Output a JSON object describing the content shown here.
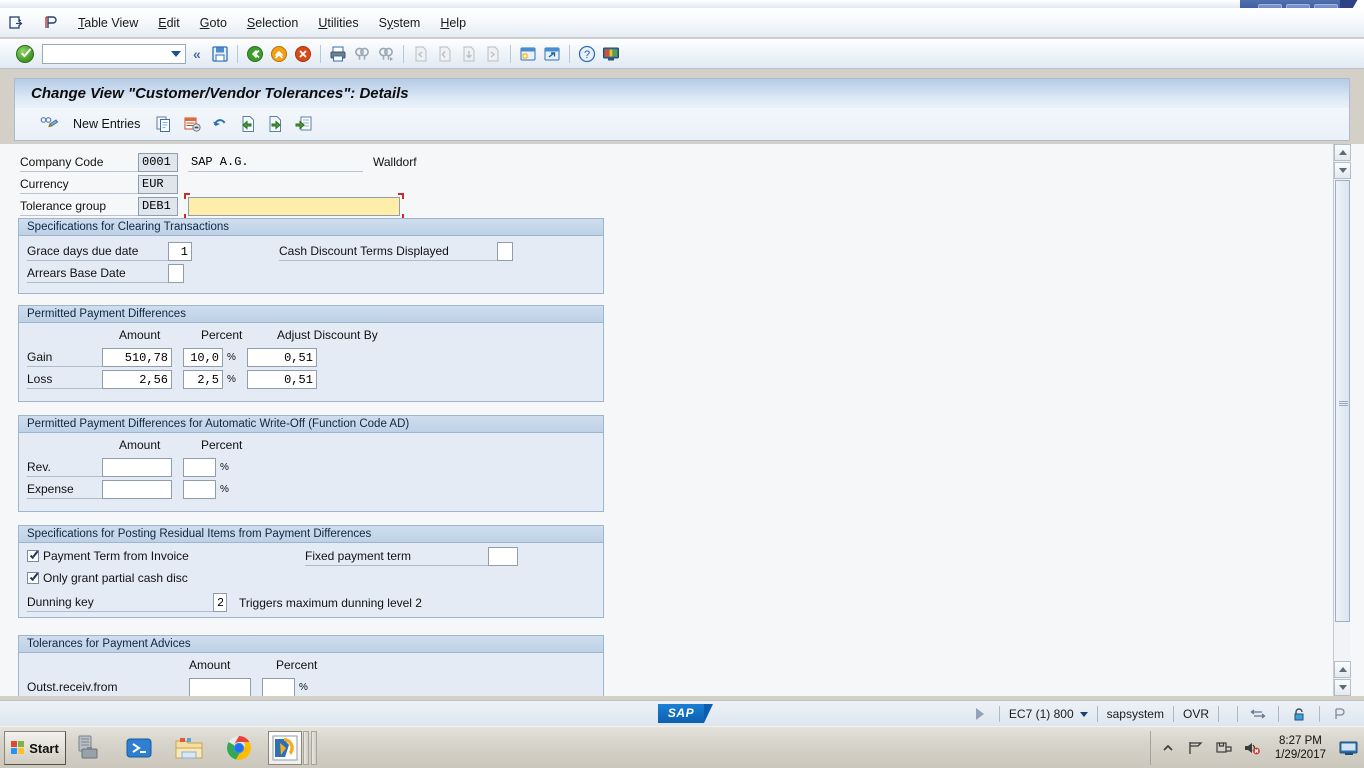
{
  "window": {
    "controls": {
      "minimize": "–",
      "restore": "❐",
      "close": "✕"
    }
  },
  "menubar": {
    "icons": [
      "exit-icon",
      "session-icon"
    ],
    "items": [
      {
        "label": "Table View",
        "accel": "T"
      },
      {
        "label": "Edit",
        "accel": "E"
      },
      {
        "label": "Goto",
        "accel": "G"
      },
      {
        "label": "Selection",
        "accel": "S"
      },
      {
        "label": "Utilities",
        "accel": "U"
      },
      {
        "label": "System",
        "accel": "y"
      },
      {
        "label": "Help",
        "accel": "H"
      }
    ]
  },
  "toolbar": {
    "enter_icon": "green-check-icon",
    "command_field_value": "",
    "command_field_placeholder": "",
    "expand_icon": "chevron-double-left-icon",
    "buttons": [
      "save-icon",
      "back-icon",
      "exit-icon",
      "cancel-icon",
      "print-icon",
      "find-icon",
      "find-next-icon",
      "first-page-icon",
      "previous-page-icon",
      "next-page-icon",
      "last-page-icon",
      "create-session-icon",
      "create-shortcut-icon",
      "help-icon",
      "customize-local-layout-icon"
    ]
  },
  "program": {
    "title": "Change View \"Customer/Vendor Tolerances\": Details"
  },
  "app_toolbar": {
    "display_change_icon": "glasses-pencil-icon",
    "new_entries_label": "New Entries",
    "buttons": [
      "copy-icon",
      "delete-icon",
      "undo-icon",
      "previous-entry-icon",
      "next-entry-icon",
      "select-layout-icon"
    ]
  },
  "header_fields": [
    {
      "label": "Company Code",
      "value": "0001",
      "extra_value": "SAP A.G.",
      "extra2": "Walldorf",
      "style": "gray"
    },
    {
      "label": "Currency",
      "value": "EUR",
      "style": "gray"
    },
    {
      "label": "Tolerance group",
      "value": "DEB1",
      "style": "gray",
      "focus_value": "",
      "focused": true
    }
  ],
  "groups": [
    {
      "title": "Specifications for Clearing Transactions",
      "fields": [
        {
          "label": "Grace days due date",
          "value": "1"
        },
        {
          "label": "Cash Discount Terms Displayed",
          "value": ""
        },
        {
          "label": "Arrears Base Date",
          "value": ""
        }
      ]
    },
    {
      "title": "Permitted Payment Differences",
      "columns": [
        "Amount",
        "Percent",
        "Adjust Discount By"
      ],
      "rows": [
        {
          "label": "Gain",
          "amount": "510,78",
          "percent": "10,0",
          "adjust": "0,51"
        },
        {
          "label": "Loss",
          "amount": "2,56",
          "percent": "2,5",
          "adjust": "0,51"
        }
      ],
      "percent_sign": "%"
    },
    {
      "title": "Permitted Payment Differences for Automatic Write-Off (Function Code AD)",
      "columns": [
        "Amount",
        "Percent"
      ],
      "rows": [
        {
          "label": "Rev.",
          "amount": "",
          "percent": ""
        },
        {
          "label": "Expense",
          "amount": "",
          "percent": ""
        }
      ],
      "percent_sign": "%"
    },
    {
      "title": "Specifications for Posting Residual Items from Payment Differences",
      "checkboxes": [
        {
          "label": "Payment Term from Invoice",
          "checked": true
        },
        {
          "label": "Only grant partial cash disc",
          "checked": true
        }
      ],
      "fixed_payment_term_label": "Fixed payment term",
      "fixed_payment_term_value": "",
      "dunning_key_label": "Dunning key",
      "dunning_key_value": "2",
      "dunning_hint": "Triggers maximum dunning level 2"
    },
    {
      "title": "Tolerances for Payment Advices",
      "columns": [
        "Amount",
        "Percent"
      ],
      "rows": [
        {
          "label": "Outst.receiv.from",
          "amount": "",
          "percent": ""
        }
      ],
      "percent_sign": "%"
    }
  ],
  "statusbar": {
    "logo": "SAP",
    "system": "EC7 (1) 800",
    "server": "sapsystem",
    "mode": "OVR",
    "icons": [
      "play-icon",
      "insert-overwrite-icon",
      "lock-icon",
      "session-icon"
    ]
  },
  "taskbar": {
    "start_label": "Start",
    "items": [
      "server-manager-icon",
      "powershell-icon",
      "file-explorer-icon",
      "chrome-icon",
      "sap-logon-icon"
    ],
    "active_index": 4,
    "tray_icons": [
      "show-hidden-icon",
      "network-icon",
      "removable-media-icon",
      "volume-muted-icon",
      "display-icon"
    ],
    "time": "8:27 PM",
    "date": "1/29/2017"
  },
  "scrollbar": {
    "position_percent": 0
  }
}
